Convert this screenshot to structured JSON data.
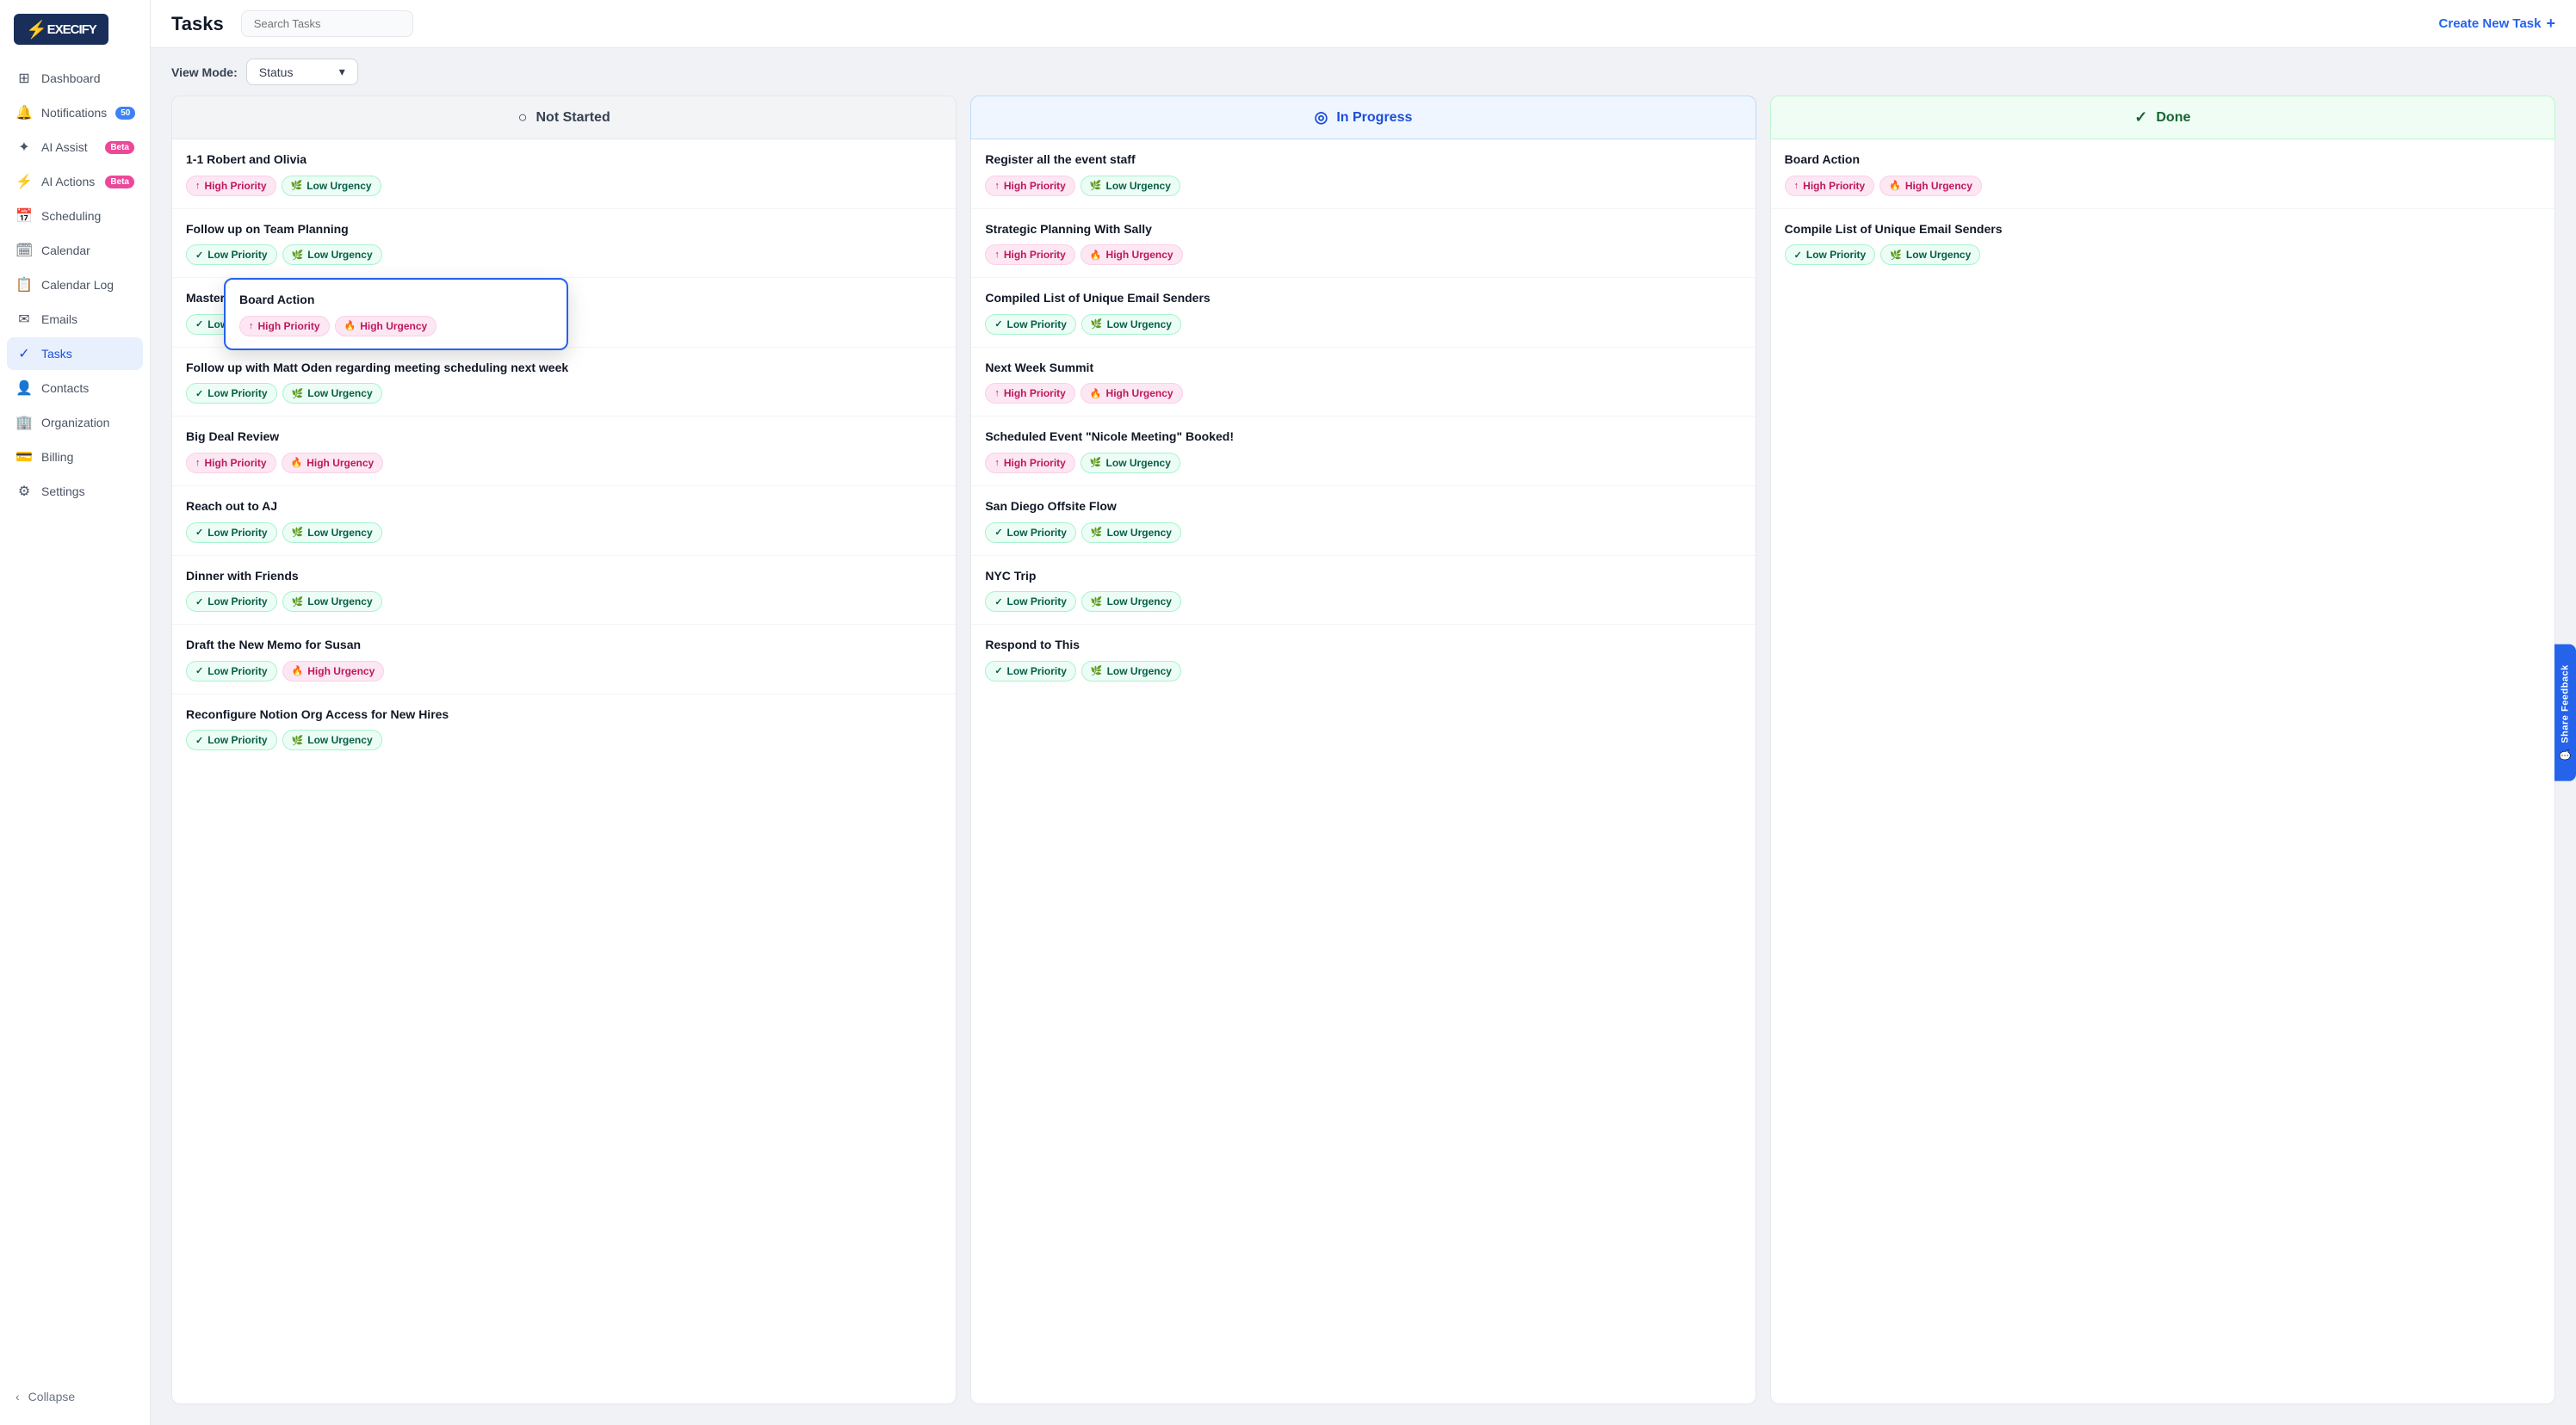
{
  "app": {
    "name": "Execify"
  },
  "sidebar": {
    "items": [
      {
        "id": "dashboard",
        "label": "Dashboard",
        "icon": "⊞",
        "active": false
      },
      {
        "id": "notifications",
        "label": "Notifications",
        "icon": "🔔",
        "badge": "50",
        "active": false
      },
      {
        "id": "ai-assist",
        "label": "AI Assist",
        "icon": "✦",
        "badge": "Beta",
        "badge_pink": true,
        "active": false
      },
      {
        "id": "ai-actions",
        "label": "AI Actions",
        "icon": "⚡",
        "badge": "Beta",
        "badge_pink": true,
        "active": false
      },
      {
        "id": "scheduling",
        "label": "Scheduling",
        "icon": "📅",
        "active": false
      },
      {
        "id": "calendar",
        "label": "Calendar",
        "icon": "🗓",
        "active": false
      },
      {
        "id": "calendar-log",
        "label": "Calendar Log",
        "icon": "📋",
        "active": false
      },
      {
        "id": "emails",
        "label": "Emails",
        "icon": "✉",
        "active": false
      },
      {
        "id": "tasks",
        "label": "Tasks",
        "icon": "✓",
        "active": true
      },
      {
        "id": "contacts",
        "label": "Contacts",
        "icon": "👤",
        "active": false
      },
      {
        "id": "organization",
        "label": "Organization",
        "icon": "🏢",
        "active": false
      },
      {
        "id": "billing",
        "label": "Billing",
        "icon": "💳",
        "active": false
      },
      {
        "id": "settings",
        "label": "Settings",
        "icon": "⚙",
        "active": false
      }
    ],
    "collapse_label": "Collapse"
  },
  "header": {
    "title": "Tasks",
    "search_placeholder": "Search Tasks",
    "create_button": "Create New Task"
  },
  "view_mode": {
    "label": "View Mode:",
    "value": "Status"
  },
  "columns": [
    {
      "id": "not-started",
      "label": "Not Started",
      "icon": "○",
      "tasks": [
        {
          "title": "1-1 Robert and Olivia",
          "priority": "high",
          "urgency": "low"
        },
        {
          "title": "Follow up on Team Planning",
          "priority": "low",
          "urgency": "low"
        },
        {
          "title": "Master Systems",
          "priority": "low",
          "urgency": "low",
          "has_floating": true
        },
        {
          "title": "Follow up with Matt Oden regarding meeting scheduling next week",
          "priority": "low",
          "urgency": "low"
        },
        {
          "title": "Big Deal Review",
          "priority": "high",
          "urgency": "high"
        },
        {
          "title": "Reach out to AJ",
          "priority": "low",
          "urgency": "low"
        },
        {
          "title": "Dinner with Friends",
          "priority": "low",
          "urgency": "low"
        },
        {
          "title": "Draft the New Memo for Susan",
          "priority": "low",
          "urgency": "high"
        },
        {
          "title": "Reconfigure Notion Org Access for New Hires",
          "priority": "low",
          "urgency": "low"
        }
      ]
    },
    {
      "id": "in-progress",
      "label": "In Progress",
      "icon": "◎",
      "tasks": [
        {
          "title": "Register all the event staff",
          "priority": "high",
          "urgency": "low"
        },
        {
          "title": "Strategic Planning With Sally",
          "priority": "high",
          "urgency": "high"
        },
        {
          "title": "Compiled List of Unique Email Senders",
          "priority": "low",
          "urgency": "low"
        },
        {
          "title": "Next Week Summit",
          "priority": "high",
          "urgency": "high"
        },
        {
          "title": "Scheduled Event \"Nicole Meeting\" Booked!",
          "priority": "high",
          "urgency": "low"
        },
        {
          "title": "San Diego Offsite Flow",
          "priority": "low",
          "urgency": "low"
        },
        {
          "title": "NYC Trip",
          "priority": "low",
          "urgency": "low"
        },
        {
          "title": "Respond to This",
          "priority": "low",
          "urgency": "low"
        }
      ]
    },
    {
      "id": "done",
      "label": "Done",
      "icon": "✓",
      "tasks": [
        {
          "title": "Board Action",
          "priority": "high",
          "urgency": "high"
        },
        {
          "title": "Compile List of Unique Email Senders",
          "priority": "low",
          "urgency": "low"
        }
      ]
    }
  ],
  "floating_card": {
    "title": "Board Action",
    "priority": "high",
    "urgency": "high"
  },
  "tags": {
    "high_priority": "High Priority",
    "low_priority": "Low Priority",
    "high_urgency": "High Urgency",
    "low_urgency": "Low Urgency"
  },
  "share_feedback": "Share Feedback"
}
